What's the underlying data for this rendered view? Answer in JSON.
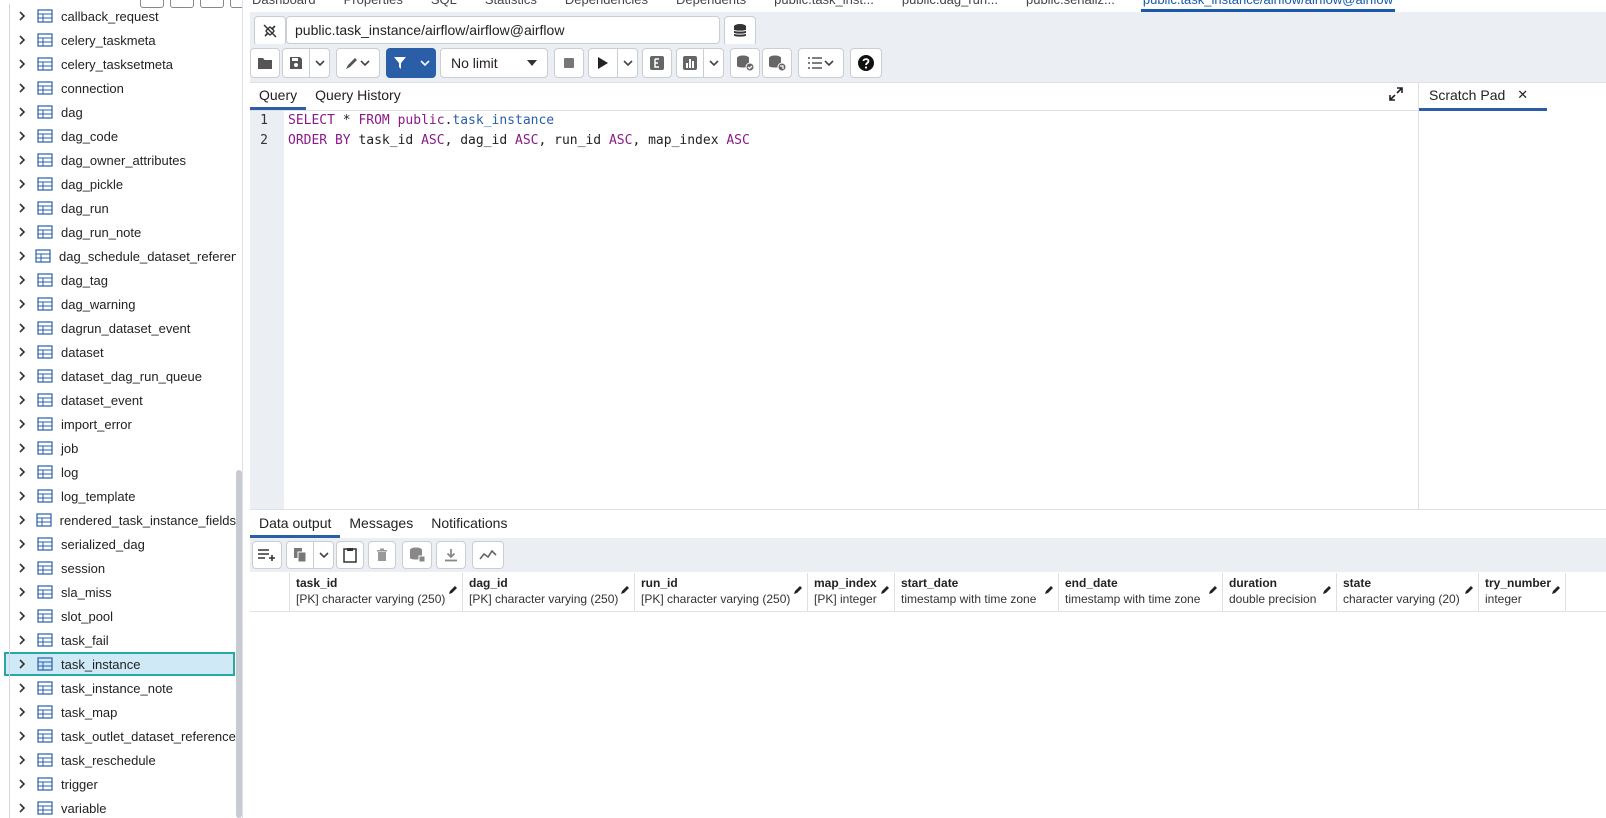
{
  "sidebar": {
    "tables": [
      {
        "label": "callback_request"
      },
      {
        "label": "celery_taskmeta"
      },
      {
        "label": "celery_tasksetmeta"
      },
      {
        "label": "connection"
      },
      {
        "label": "dag"
      },
      {
        "label": "dag_code"
      },
      {
        "label": "dag_owner_attributes"
      },
      {
        "label": "dag_pickle"
      },
      {
        "label": "dag_run"
      },
      {
        "label": "dag_run_note"
      },
      {
        "label": "dag_schedule_dataset_referen"
      },
      {
        "label": "dag_tag"
      },
      {
        "label": "dag_warning"
      },
      {
        "label": "dagrun_dataset_event"
      },
      {
        "label": "dataset"
      },
      {
        "label": "dataset_dag_run_queue"
      },
      {
        "label": "dataset_event"
      },
      {
        "label": "import_error"
      },
      {
        "label": "job"
      },
      {
        "label": "log"
      },
      {
        "label": "log_template"
      },
      {
        "label": "rendered_task_instance_fields"
      },
      {
        "label": "serialized_dag"
      },
      {
        "label": "session"
      },
      {
        "label": "sla_miss"
      },
      {
        "label": "slot_pool"
      },
      {
        "label": "task_fail"
      },
      {
        "label": "task_instance"
      },
      {
        "label": "task_instance_note"
      },
      {
        "label": "task_map"
      },
      {
        "label": "task_outlet_dataset_reference"
      },
      {
        "label": "task_reschedule"
      },
      {
        "label": "trigger"
      },
      {
        "label": "variable"
      }
    ],
    "selected_index": 27
  },
  "top_tabs": [
    {
      "label": "Dashboard"
    },
    {
      "label": "Properties"
    },
    {
      "label": "SQL"
    },
    {
      "label": "Statistics"
    },
    {
      "label": "Dependencies"
    },
    {
      "label": "Dependents"
    },
    {
      "label": "public.task_inst..."
    },
    {
      "label": "public.dag_run..."
    },
    {
      "label": "public.serializ..."
    },
    {
      "label": "public.task_instance/airflow/airflow@airflow"
    }
  ],
  "connection": {
    "value": "public.task_instance/airflow/airflow@airflow"
  },
  "toolbar": {
    "limit_label": "No limit"
  },
  "query_tabs": [
    {
      "label": "Query"
    },
    {
      "label": "Query History"
    }
  ],
  "scratch_pad": {
    "label": "Scratch Pad",
    "close": "✕"
  },
  "editor": {
    "line_numbers": [
      "1",
      "2"
    ],
    "line1": {
      "kw1": "SELECT",
      "star": " * ",
      "kw2": "FROM",
      "schema": " public",
      "dot": ".",
      "table": "task_instance"
    },
    "line2": {
      "kw1": "ORDER BY",
      "c1": " task_id ",
      "a1": "ASC",
      "s1": ", dag_id ",
      "a2": "ASC",
      "s2": ", run_id ",
      "a3": "ASC",
      "s3": ", map_index ",
      "a4": "ASC"
    }
  },
  "result_tabs": [
    {
      "label": "Data output"
    },
    {
      "label": "Messages"
    },
    {
      "label": "Notifications"
    }
  ],
  "columns": [
    {
      "name": "task_id",
      "type": "[PK] character varying (250)"
    },
    {
      "name": "dag_id",
      "type": "[PK] character varying (250)"
    },
    {
      "name": "run_id",
      "type": "[PK] character varying (250)"
    },
    {
      "name": "map_index",
      "type": "[PK] integer"
    },
    {
      "name": "start_date",
      "type": "timestamp with time zone"
    },
    {
      "name": "end_date",
      "type": "timestamp with time zone"
    },
    {
      "name": "duration",
      "type": "double precision"
    },
    {
      "name": "state",
      "type": "character varying (20)"
    },
    {
      "name": "try_number",
      "type": "integer"
    }
  ],
  "colors": {
    "accent": "#2a5fa8",
    "selection_bg": "#cfe9f7",
    "selection_border": "#2aa7a0",
    "keyword": "#8a1a8a",
    "identifier": "#2a5fa8"
  }
}
